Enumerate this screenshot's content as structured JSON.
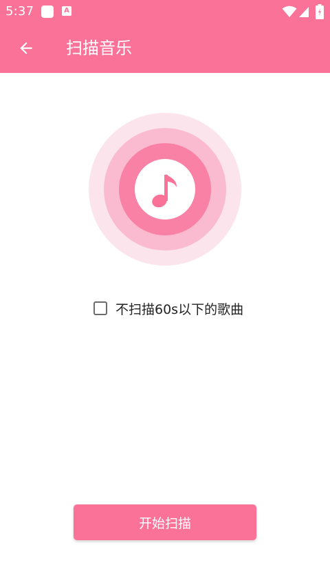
{
  "status_bar": {
    "time": "5:37",
    "icons": [
      "rounded-square-icon",
      "a-icon",
      "wifi-icon",
      "signal-icon",
      "battery-icon"
    ],
    "a_icon_text": "A"
  },
  "app_bar": {
    "title": "扫描音乐",
    "back_icon": "arrow-left-icon"
  },
  "illustration": {
    "icon": "music-note-icon",
    "ring_colors": [
      "#FCE4EC",
      "#FABBD0",
      "#F981A5"
    ]
  },
  "options": {
    "skip_short_label": "不扫描60s以下的歌曲",
    "skip_short_checked": false
  },
  "actions": {
    "start_label": "开始扫描"
  },
  "colors": {
    "primary": "#FB7299"
  }
}
